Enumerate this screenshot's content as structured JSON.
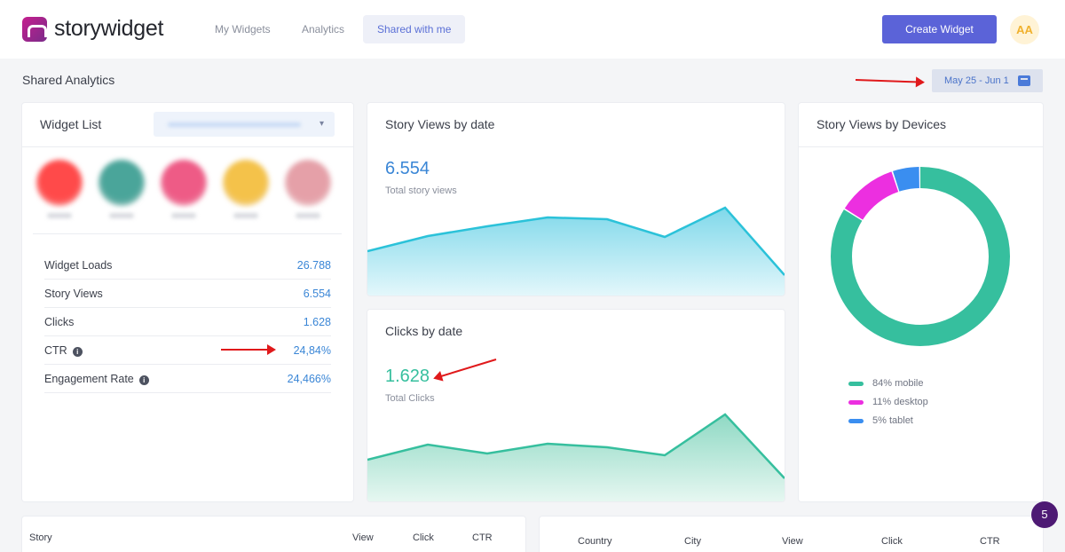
{
  "brand": {
    "name": "storywidget"
  },
  "nav": {
    "tabs": [
      {
        "label": "My Widgets"
      },
      {
        "label": "Analytics"
      },
      {
        "label": "Shared with me"
      }
    ],
    "create_label": "Create Widget",
    "avatar_initials": "AA"
  },
  "page": {
    "title": "Shared Analytics",
    "date_range": "May 25 - Jun 1"
  },
  "widget_list": {
    "title": "Widget List",
    "thumbnail_colors": [
      "#ff4a4a",
      "#4aa59a",
      "#ee5b86",
      "#f4c24a",
      "#e5a0a8"
    ],
    "metrics": [
      {
        "label": "Widget Loads",
        "value": "26.788",
        "info": false
      },
      {
        "label": "Story Views",
        "value": "6.554",
        "info": false
      },
      {
        "label": "Clicks",
        "value": "1.628",
        "info": false
      },
      {
        "label": "CTR",
        "value": "24,84%",
        "info": true
      },
      {
        "label": "Engagement Rate",
        "value": "24,466%",
        "info": true
      }
    ]
  },
  "story_views": {
    "title": "Story Views by date",
    "total": "6.554",
    "total_label": "Total story views",
    "color": "#2bc2d9"
  },
  "clicks": {
    "title": "Clicks by date",
    "total": "1.628",
    "total_label": "Total Clicks",
    "color": "#36bf9e"
  },
  "devices": {
    "title": "Story Views by Devices",
    "items": [
      {
        "label": "84% mobile",
        "percent": 84,
        "color": "#36bf9e"
      },
      {
        "label": "11% desktop",
        "percent": 11,
        "color": "#ec2fe0"
      },
      {
        "label": "5% tablet",
        "percent": 5,
        "color": "#3a8ef0"
      }
    ]
  },
  "stories_table": {
    "headers": [
      "Story",
      "View",
      "Click",
      "CTR"
    ]
  },
  "countries_table": {
    "headers": [
      "Country",
      "City",
      "View",
      "Click",
      "CTR"
    ]
  },
  "notification_count": "5"
}
